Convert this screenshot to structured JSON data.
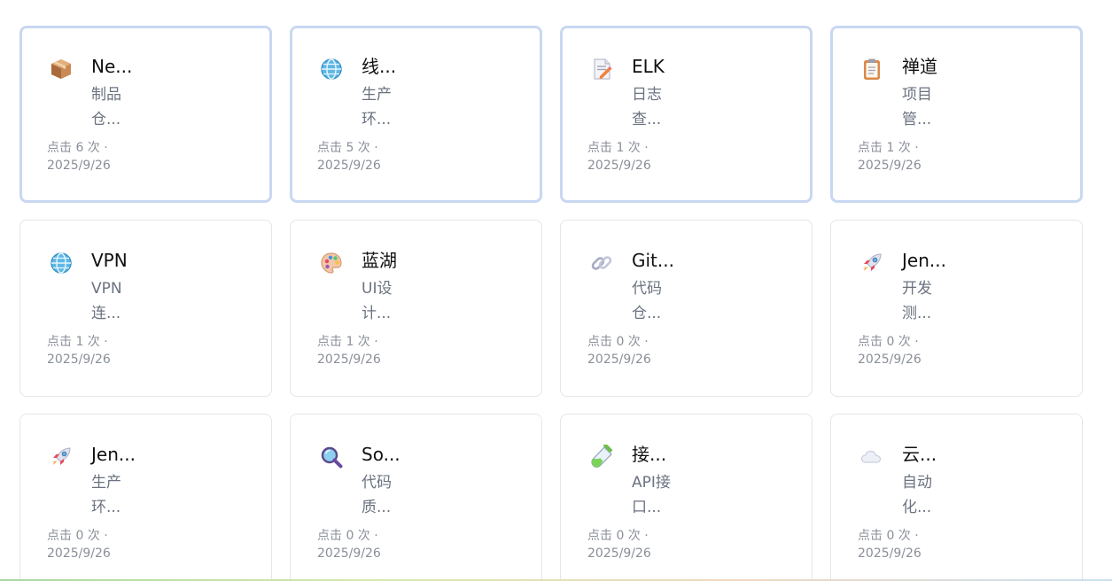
{
  "cards": [
    {
      "name": "Ne...",
      "desc1": "制品",
      "desc2": "仓...",
      "clicks": "点击 6 次 ·",
      "date": "2025/9/26",
      "icon": "package-icon",
      "pinned": true
    },
    {
      "name": "线...",
      "desc1": "生产",
      "desc2": "环...",
      "clicks": "点击 5 次 ·",
      "date": "2025/9/26",
      "icon": "globe-icon",
      "pinned": true
    },
    {
      "name": "ELK",
      "desc1": "日志",
      "desc2": "查...",
      "clicks": "点击 1 次 ·",
      "date": "2025/9/26",
      "icon": "memo-icon",
      "pinned": true
    },
    {
      "name": "禅道",
      "desc1": "项目",
      "desc2": "管...",
      "clicks": "点击 1 次 ·",
      "date": "2025/9/26",
      "icon": "clipboard-icon",
      "pinned": true
    },
    {
      "name": "VPN",
      "desc1": "VPN",
      "desc2": "连...",
      "clicks": "点击 1 次 ·",
      "date": "2025/9/26",
      "icon": "globe-icon",
      "pinned": false
    },
    {
      "name": "蓝湖",
      "desc1": "UI设",
      "desc2": "计...",
      "clicks": "点击 1 次 ·",
      "date": "2025/9/26",
      "icon": "palette-icon",
      "pinned": false
    },
    {
      "name": "Git...",
      "desc1": "代码",
      "desc2": "仓...",
      "clicks": "点击 0 次 ·",
      "date": "2025/9/26",
      "icon": "link-icon",
      "pinned": false
    },
    {
      "name": "Jen...",
      "desc1": "开发",
      "desc2": "测...",
      "clicks": "点击 0 次 ·",
      "date": "2025/9/26",
      "icon": "rocket-icon",
      "pinned": false
    },
    {
      "name": "Jen...",
      "desc1": "生产",
      "desc2": "环...",
      "clicks": "点击 0 次 ·",
      "date": "2025/9/26",
      "icon": "rocket-icon",
      "pinned": false
    },
    {
      "name": "So...",
      "desc1": "代码",
      "desc2": "质...",
      "clicks": "点击 0 次 ·",
      "date": "2025/9/26",
      "icon": "magnifier-icon",
      "pinned": false
    },
    {
      "name": "接...",
      "desc1": "API接",
      "desc2": "口...",
      "clicks": "点击 0 次 ·",
      "date": "2025/9/26",
      "icon": "test-tube-icon",
      "pinned": false
    },
    {
      "name": "云...",
      "desc1": "自动",
      "desc2": "化...",
      "clicks": "点击 0 次 ·",
      "date": "2025/9/26",
      "icon": "cloud-icon",
      "pinned": false
    }
  ]
}
